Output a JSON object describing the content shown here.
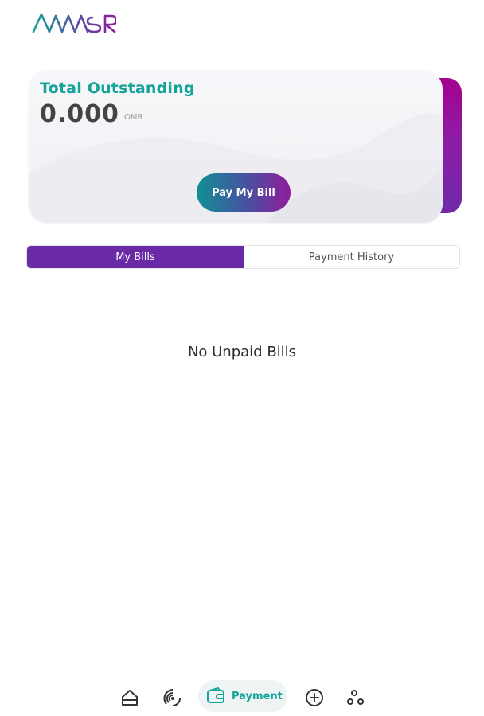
{
  "brand": {
    "logo_text": "AWASR",
    "colors": {
      "teal": "#16a39a",
      "purple": "#6a2aa6",
      "magenta": "#a3008f"
    }
  },
  "outstanding": {
    "title": "Total Outstanding",
    "amount": "0.000",
    "currency": "OMR",
    "pay_button_label": "Pay My Bill"
  },
  "tabs": [
    {
      "label": "My Bills",
      "active": true
    },
    {
      "label": "Payment History",
      "active": false
    }
  ],
  "main": {
    "empty_message": "No Unpaid Bills"
  },
  "bottom_nav": {
    "items": [
      {
        "icon": "home-icon"
      },
      {
        "icon": "signal-icon"
      },
      {
        "icon": "wallet-icon",
        "label": "Payment",
        "active": true
      },
      {
        "icon": "add-circle-icon"
      },
      {
        "icon": "more-dots-icon"
      }
    ]
  }
}
